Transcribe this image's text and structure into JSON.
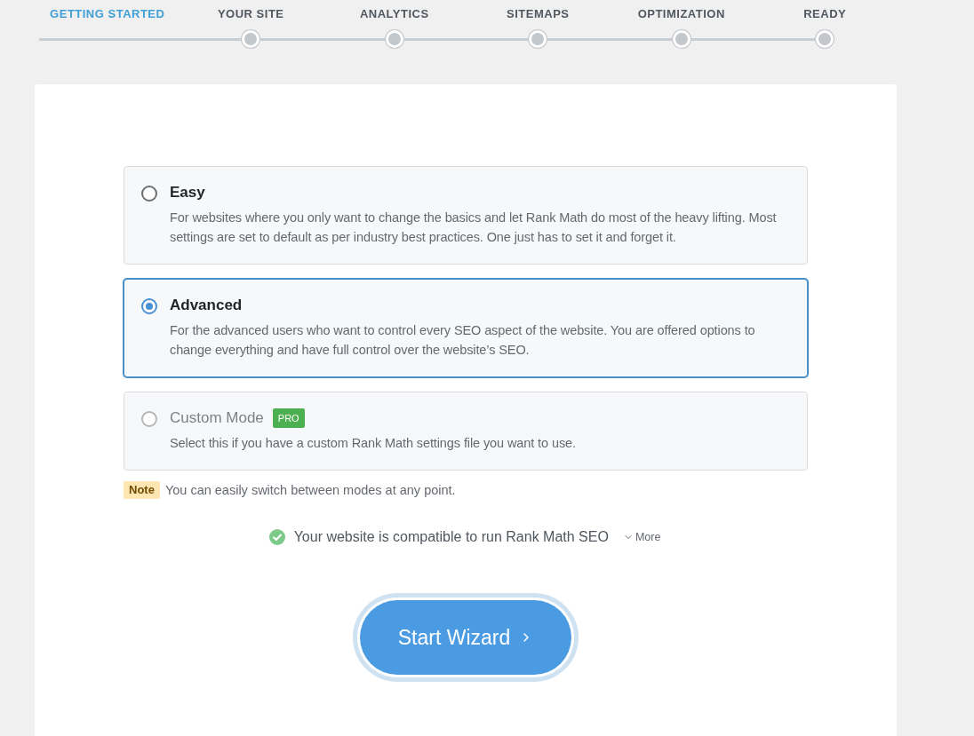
{
  "steps": [
    {
      "label": "GETTING STARTED",
      "selected": true
    },
    {
      "label": "YOUR SITE",
      "selected": false
    },
    {
      "label": "ANALYTICS",
      "selected": false
    },
    {
      "label": "SITEMAPS",
      "selected": false
    },
    {
      "label": "OPTIMIZATION",
      "selected": false
    },
    {
      "label": "READY",
      "selected": false
    }
  ],
  "modes": [
    {
      "title": "Easy",
      "description": "For websites where you only want to change the basics and let Rank Math do most of the heavy lifting. Most settings are set to default as per industry best practices. One just has to set it and forget it.",
      "selected": false,
      "disabled": false
    },
    {
      "title": "Advanced",
      "description": "For the advanced users who want to control every SEO aspect of the website. You are offered options to change everything and have full control over the website’s SEO.",
      "selected": true,
      "disabled": false
    },
    {
      "title": "Custom Mode",
      "badge": "PRO",
      "description": "Select this if you have a custom Rank Math settings file you want to use.",
      "selected": false,
      "disabled": true
    }
  ],
  "note": {
    "label": "Note",
    "text": "You can easily switch between modes at any point."
  },
  "compatibility": {
    "text": "Your website is compatible to run Rank Math SEO",
    "more": "More",
    "expanded": false
  },
  "start_button": {
    "label": "Start Wizard"
  }
}
